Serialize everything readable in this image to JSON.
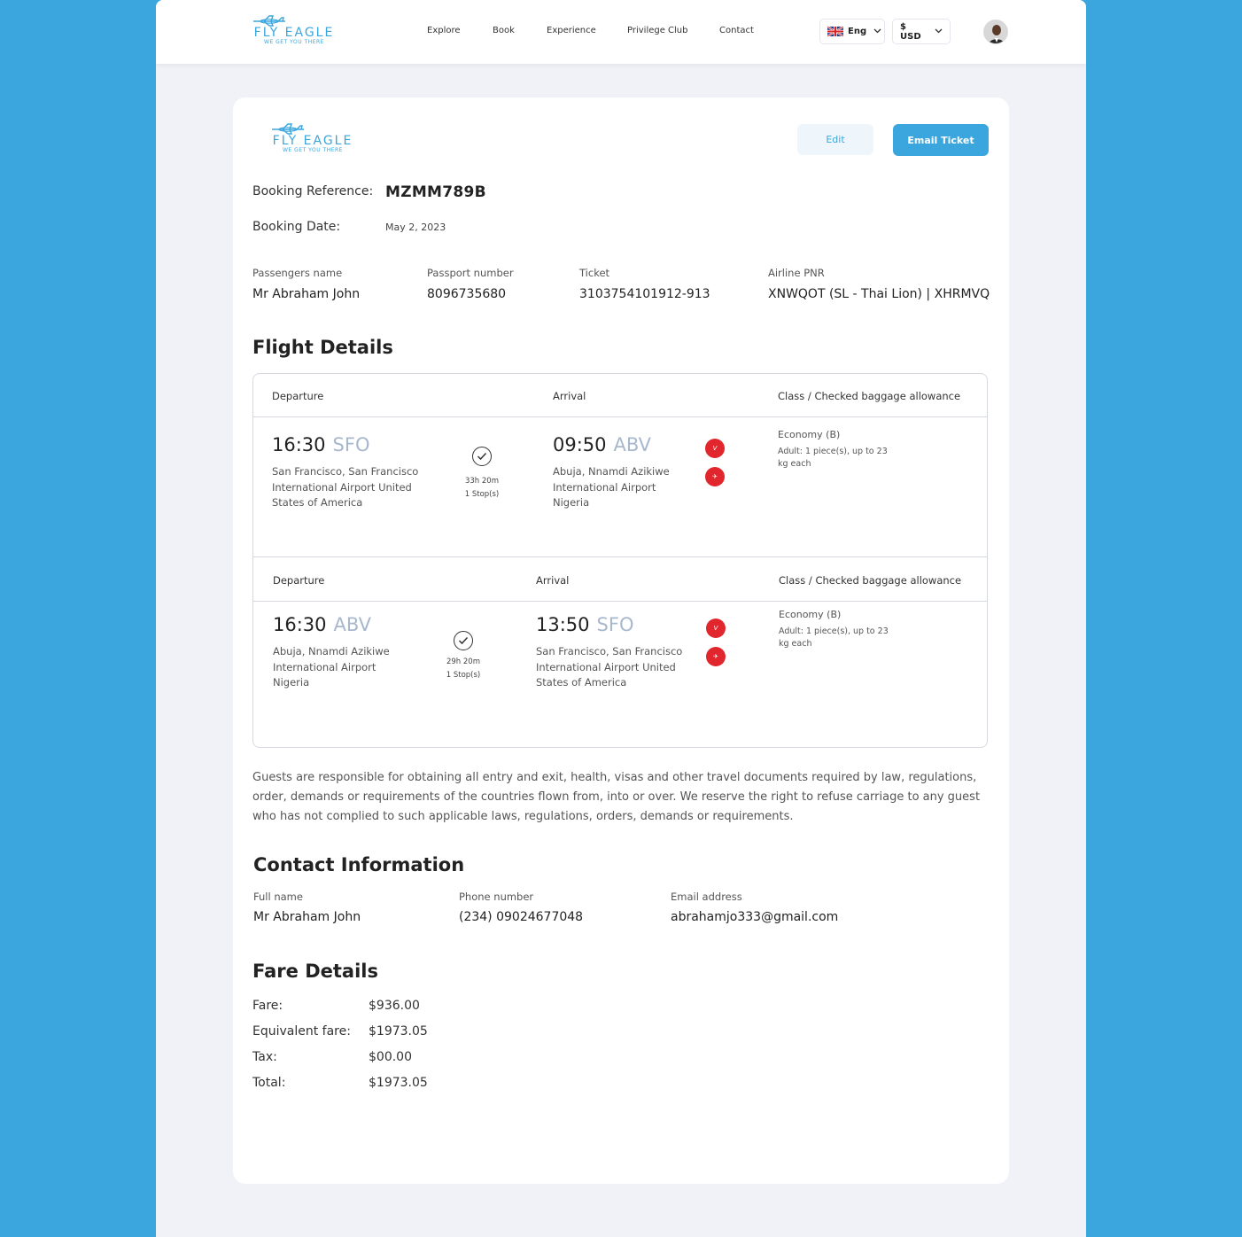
{
  "brand": {
    "name": "FLY EAGLE",
    "tagline": "WE GET YOU THERE",
    "accent_color": "#3aa6dd"
  },
  "nav": {
    "items": [
      "Explore",
      "Book",
      "Experience",
      "Privilege Club",
      "Contact"
    ],
    "language": "Eng",
    "currency": "$ USD"
  },
  "ticket": {
    "edit_label": "Edit",
    "email_label": "Email Ticket",
    "booking_reference_label": "Booking Reference:",
    "booking_reference": "MZMM789B",
    "booking_date_label": "Booking Date:",
    "booking_date": "May 2, 2023",
    "passenger": {
      "name_label": "Passengers name",
      "name": "Mr Abraham John",
      "passport_label": "Passport number",
      "passport": "8096735680",
      "ticket_label": "Ticket",
      "ticket": "3103754101912-913",
      "pnr_label": "Airline PNR",
      "pnr": "XNWQOT (SL - Thai Lion) | XHRMVQ"
    }
  },
  "flight_details": {
    "title": "Flight Details",
    "segments": [
      {
        "departure_header": "Departure",
        "arrival_header": "Arrival",
        "class_header": "Class / Checked baggage allowance",
        "dep_time": "16:30",
        "dep_code": "SFO",
        "dep_place": "San Francisco, San Francisco International Airport United States of America",
        "duration": "33h 20m",
        "stops": "1 Stop(s)",
        "arr_time": "09:50",
        "arr_code": "ABV",
        "arr_place": "Abuja, Nnamdi Azikiwe International Airport Nigeria",
        "class": "Economy (B)",
        "baggage": "Adult: 1 piece(s), up to 23 kg each"
      },
      {
        "departure_header": "Departure",
        "arrival_header": "Arrival",
        "class_header": "Class / Checked baggage allowance",
        "dep_time": "16:30",
        "dep_code": "ABV",
        "dep_place": "Abuja, Nnamdi Azikiwe International Airport Nigeria",
        "duration": "29h 20m",
        "stops": "1 Stop(s)",
        "arr_time": "13:50",
        "arr_code": "SFO",
        "arr_place": "San Francisco, San Francisco International Airport United States of America",
        "class": "Economy (B)",
        "baggage": "Adult: 1 piece(s), up to 23 kg each"
      }
    ]
  },
  "notice": "Guests are responsible for obtaining all entry and exit, health, visas and other travel documents required by law, regulations, order, demands or requirements of the countries flown from, into or over. We reserve the right to refuse carriage to any guest who has not complied to such applicable laws, regulations, orders, demands or requirements.",
  "contact": {
    "title": "Contact Information",
    "name_label": "Full name",
    "name": "Mr Abraham John",
    "phone_label": "Phone number",
    "phone": "(234) 09024677048",
    "email_label": "Email address",
    "email": "abrahamjo333@gmail.com"
  },
  "fare": {
    "title": "Fare Details",
    "rows": [
      {
        "label": "Fare:",
        "value": "$936.00"
      },
      {
        "label": "Equivalent fare:",
        "value": "$1973.05"
      },
      {
        "label": "Tax:",
        "value": "$00.00"
      },
      {
        "label": "Total:",
        "value": "$1973.05"
      }
    ]
  }
}
